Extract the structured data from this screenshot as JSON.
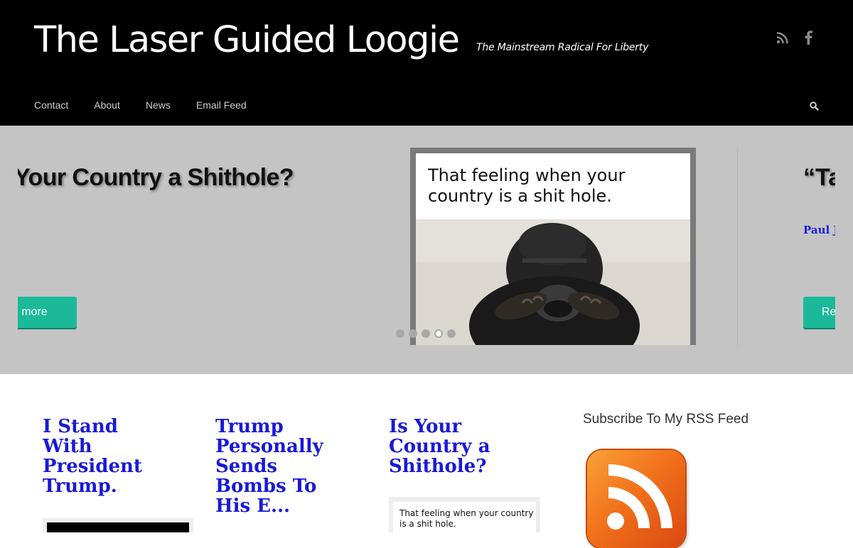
{
  "site": {
    "title": "The Laser Guided Loogie",
    "tagline": "The Mainstream Radical For Liberty"
  },
  "social": [
    {
      "icon": "rss-icon"
    },
    {
      "icon": "facebook-icon"
    }
  ],
  "nav": {
    "items": [
      {
        "label": "Contact"
      },
      {
        "label": "About"
      },
      {
        "label": "News"
      },
      {
        "label": "Email Feed"
      }
    ],
    "search_icon": "search-icon"
  },
  "slider": {
    "slide_left": {
      "title": "Your Country a Shithole?",
      "button": "ad more"
    },
    "image": {
      "caption": "That feeling when your country is a shit hole."
    },
    "slide_right": {
      "title": "“Ta",
      "excerpt": "Paul Jo profess",
      "button": "Re"
    },
    "dots": 5,
    "active_dot": 4
  },
  "posts": [
    {
      "title": "I Stand With President Trump."
    },
    {
      "title": "Trump Personally Sends Bombs To His E..."
    },
    {
      "title": "Is Your Country a Shithole?",
      "thumb_caption": "That feeling when your country is a shit hole."
    }
  ],
  "sidebar": {
    "widget_title": "Subscribe To My RSS Feed",
    "rss_icon": "rss-feed-icon"
  },
  "colors": {
    "header_bg": "#000000",
    "slider_bg": "#c4c4c4",
    "button_teal": "#1bb99a",
    "post_title_blue": "#1919d6",
    "rss_orange": "#f2721c"
  }
}
